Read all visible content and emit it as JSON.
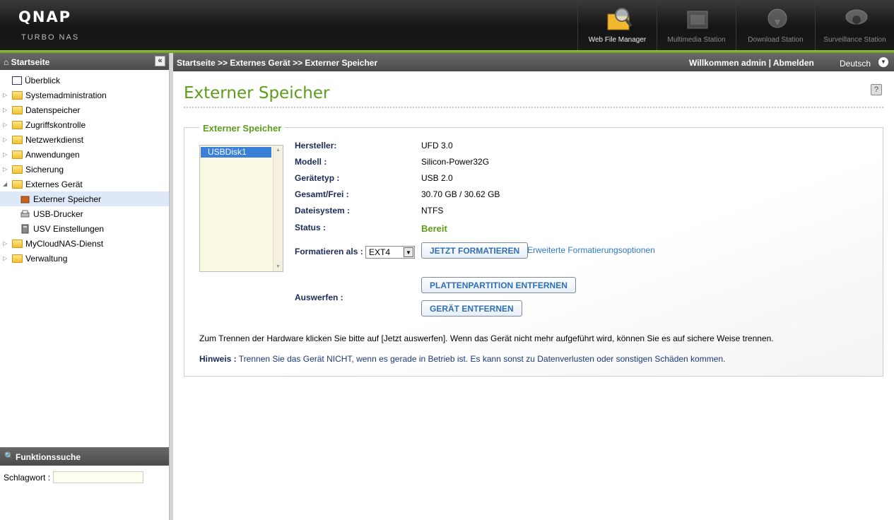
{
  "header": {
    "logo": "QNAP",
    "logo_sub": "Turbo NAS",
    "apps": [
      {
        "label": "Web File Manager",
        "icon": "folder-magnifier-icon"
      },
      {
        "label": "Multimedia Station",
        "icon": "film-icon"
      },
      {
        "label": "Download Station",
        "icon": "globe-download-icon"
      },
      {
        "label": "Surveillance Station",
        "icon": "camera-icon"
      }
    ]
  },
  "sidebar": {
    "title": "Startseite",
    "collapse_glyph": "«",
    "items": [
      {
        "label": "Überblick"
      },
      {
        "label": "Systemadministration"
      },
      {
        "label": "Datenspeicher"
      },
      {
        "label": "Zugriffskontrolle"
      },
      {
        "label": "Netzwerkdienst"
      },
      {
        "label": "Anwendungen"
      },
      {
        "label": "Sicherung"
      },
      {
        "label": "Externes Gerät",
        "expanded": true
      },
      {
        "label": "Externer Speicher",
        "selected": true
      },
      {
        "label": "USB-Drucker"
      },
      {
        "label": "USV Einstellungen"
      },
      {
        "label": "MyCloudNAS-Dienst"
      },
      {
        "label": "Verwaltung"
      }
    ]
  },
  "search": {
    "title": "Funktionssuche",
    "keyword_label": "Schlagwort :",
    "keyword_value": ""
  },
  "breadcrumb": {
    "path": "Startseite >> Externes Gerät >> Externer Speicher",
    "welcome": "Willkommen admin | Abmelden",
    "language": "Deutsch"
  },
  "main": {
    "title": "Externer Speicher",
    "help": "?",
    "section_title": "Externer Speicher",
    "disks": [
      "USBDisk1"
    ],
    "labels": {
      "vendor": "Hersteller:",
      "model": "Modell :",
      "device_type": "Gerätetyp :",
      "total_free": "Gesamt/Frei :",
      "filesystem": "Dateisystem :",
      "status": "Status :",
      "format_as": "Formatieren als :",
      "eject": "Auswerfen :"
    },
    "values": {
      "vendor": "UFD 3.0",
      "model": "Silicon-Power32G",
      "device_type": "USB 2.0",
      "total_free": "30.70 GB / 30.62 GB",
      "filesystem": "NTFS",
      "status": "Bereit"
    },
    "format_option": "EXT4",
    "buttons": {
      "format_now": "JETZT FORMATIEREN",
      "remove_partition": "PLATTENPARTITION ENTFERNEN",
      "remove_device": "GERÄT ENTFERNEN"
    },
    "advanced_link": "Erweiterte Formatierungsoptionen",
    "note1": "Zum Trennen der Hardware klicken Sie bitte auf [Jetzt auswerfen]. Wenn das Gerät nicht mehr aufgeführt wird, können Sie es auf sichere Weise trennen.",
    "note2_label": "Hinweis :",
    "note2_text": " Trennen Sie das Gerät NICHT, wenn es gerade in Betrieb ist. Es kann sonst zu Datenverlusten oder sonstigen Schäden kommen."
  },
  "colors": {
    "accent_green": "#5c9c1a",
    "link_blue": "#2f79c4",
    "selection_blue": "#3a7fd8"
  }
}
